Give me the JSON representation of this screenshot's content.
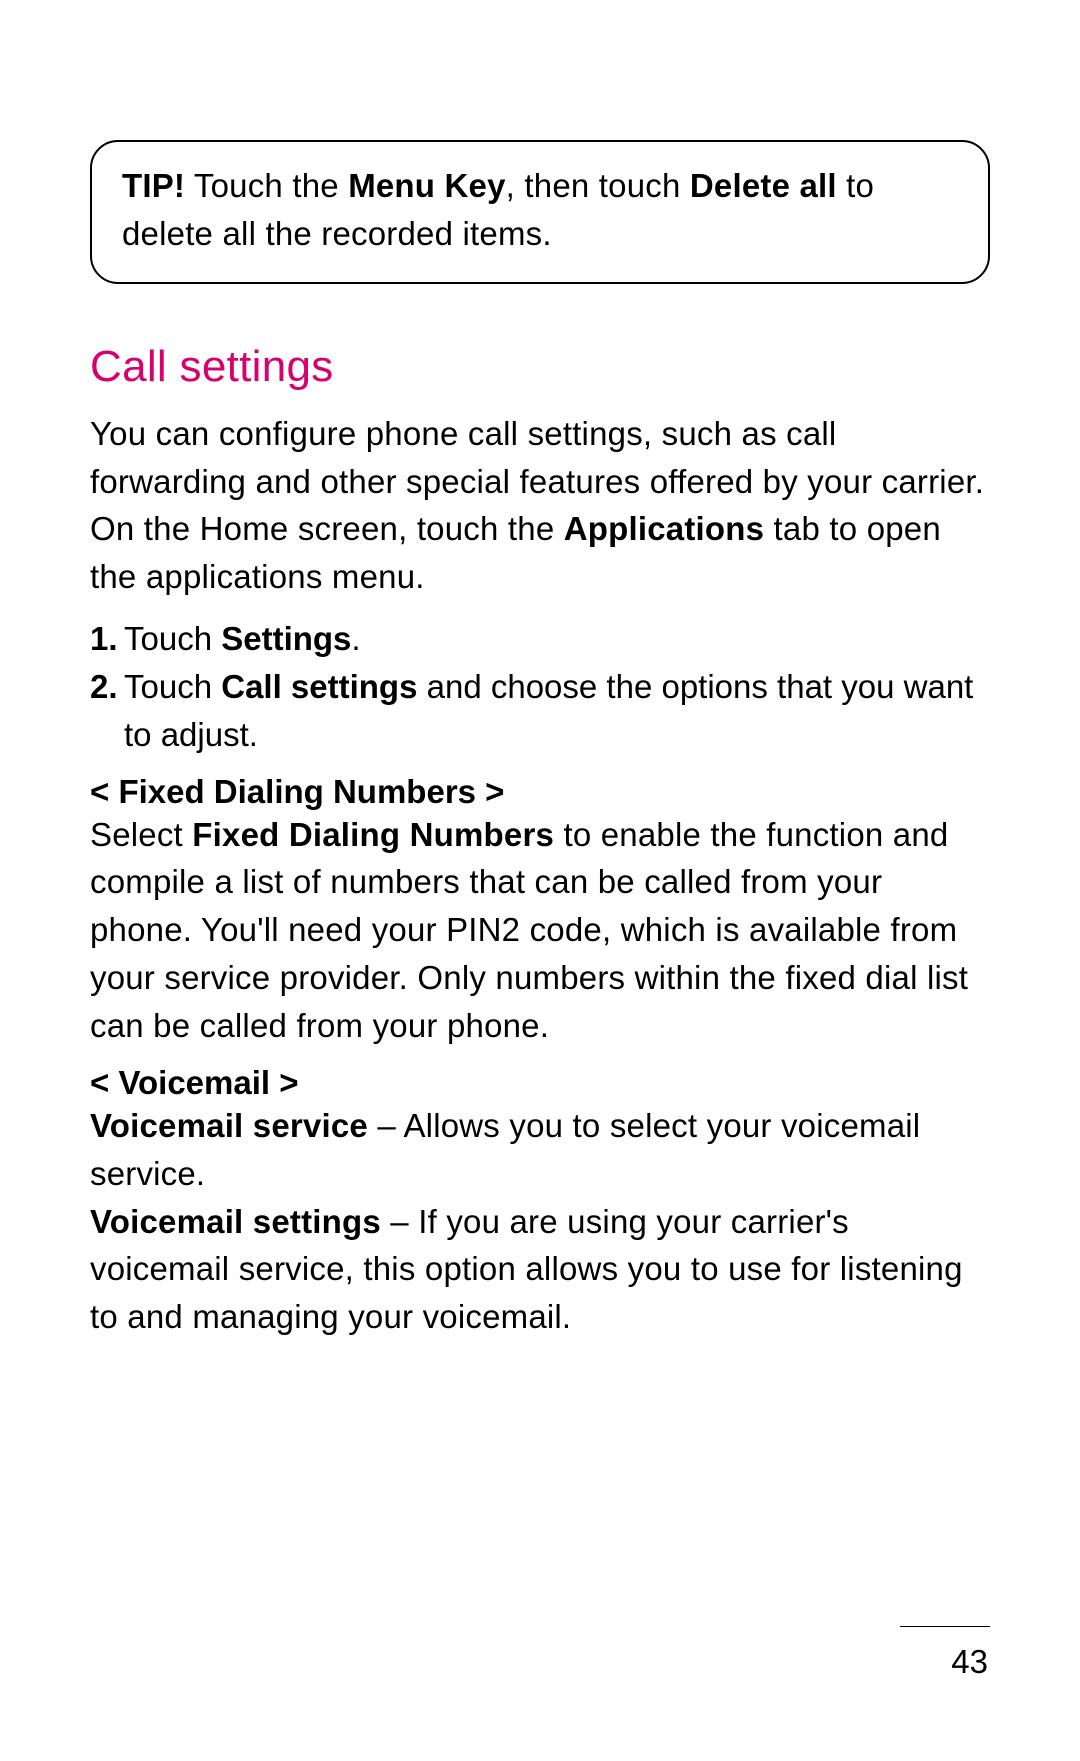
{
  "tip": {
    "prefix": "TIP!",
    "text1": " Touch the ",
    "bold1": "Menu Key",
    "text2": ", then touch ",
    "bold2": "Delete all",
    "text3": " to delete all the recorded items."
  },
  "heading": "Call settings",
  "intro1": "You can configure phone call settings, such as call forwarding and other special features offered by your carrier.",
  "intro2_a": "On the Home screen, touch the ",
  "intro2_b": "Applications",
  "intro2_c": " tab to open the applications menu.",
  "steps": [
    {
      "num": "1.",
      "a": "Touch ",
      "b": "Settings",
      "c": "."
    },
    {
      "num": "2.",
      "a": "Touch ",
      "b": "Call settings",
      "c": " and choose the options that you want to adjust."
    }
  ],
  "fdn": {
    "title": "< Fixed Dialing Numbers >",
    "a": "Select ",
    "b": "Fixed Dialing Numbers",
    "c": " to enable the function and compile a list of numbers that can be called from your phone. You'll need your PIN2 code, which is available from your service provider. Only numbers within the fixed dial list can be called from your phone."
  },
  "vm": {
    "title": "< Voicemail >",
    "svc_b": "Voicemail service",
    "svc_t": " – Allows you to select your voicemail service.",
    "set_b": "Voicemail settings",
    "set_t": " – If you are using your carrier's voicemail service, this option allows you to use for listening to and managing your voicemail."
  },
  "page_number": "43"
}
